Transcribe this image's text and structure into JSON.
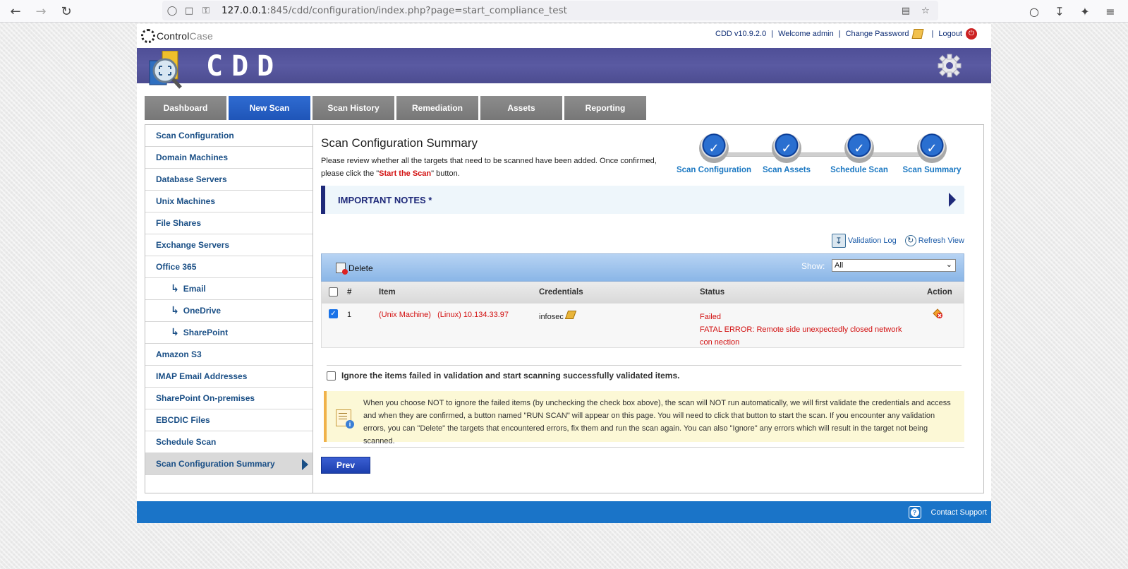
{
  "browser": {
    "url_host": "127.0.0.1",
    "url_rest": ":845/cdd/configuration/index.php?page=start_compliance_test"
  },
  "app": {
    "logo_left": "Control",
    "logo_right": "Case",
    "version": "CDD v10.9.2.0",
    "welcome": "Welcome admin",
    "change_password": "Change Password",
    "logout": "Logout",
    "brand": "CDD"
  },
  "tabs": [
    {
      "label": "Dashboard"
    },
    {
      "label": "New Scan"
    },
    {
      "label": "Scan History"
    },
    {
      "label": "Remediation"
    },
    {
      "label": "Assets"
    },
    {
      "label": "Reporting"
    }
  ],
  "sidebar": {
    "items": [
      {
        "label": "Scan Configuration"
      },
      {
        "label": "Domain Machines"
      },
      {
        "label": "Database Servers"
      },
      {
        "label": "Unix Machines"
      },
      {
        "label": "File Shares"
      },
      {
        "label": "Exchange Servers"
      },
      {
        "label": "Office 365"
      },
      {
        "label": "Email"
      },
      {
        "label": "OneDrive"
      },
      {
        "label": "SharePoint"
      },
      {
        "label": "Amazon S3"
      },
      {
        "label": "IMAP Email Addresses"
      },
      {
        "label": "SharePoint On-premises"
      },
      {
        "label": "EBCDIC Files"
      },
      {
        "label": "Schedule Scan"
      },
      {
        "label": "Scan Configuration Summary"
      }
    ]
  },
  "main": {
    "title": "Scan Configuration Summary",
    "desc_1": "Please review whether all the targets that need to be scanned have been added. Once confirmed, please click the \"",
    "desc_highlight": "Start the Scan",
    "desc_2": "\" button.",
    "steps": [
      {
        "label": "Scan Configuration"
      },
      {
        "label": "Scan Assets"
      },
      {
        "label": "Schedule Scan"
      },
      {
        "label": "Scan Summary"
      }
    ],
    "important_notes": "IMPORTANT NOTES *",
    "validation_log": "Validation Log",
    "refresh_view": "Refresh View"
  },
  "table": {
    "delete_label": "Delete",
    "show_label": "Show:",
    "show_value": "All",
    "headers": {
      "num": "#",
      "item": "Item",
      "credentials": "Credentials",
      "status": "Status",
      "action": "Action"
    },
    "rows": [
      {
        "num": "1",
        "item": "(Unix Machine)   (Linux) 10.134.33.97",
        "credentials": "infosec",
        "status": "Failed",
        "error": "FATAL ERROR: Remote side unexpectedly closed network con nection"
      }
    ]
  },
  "ignore_label": "Ignore the items failed in validation and start scanning successfully validated items.",
  "info_text": "When you choose NOT to ignore the failed items (by unchecking the check box above), the scan will NOT run automatically, we will first validate the credentials and access and when they are confirmed, a button named \"RUN SCAN\" will appear on this page. You will need to click that button to start the scan. If you encounter any validation errors, you can \"Delete\" the targets that encountered errors, fix them and run the scan again. You can also \"Ignore\" any errors which will result in the target not being scanned.",
  "prev_label": "Prev",
  "footer": {
    "contact_support": "Contact Support"
  },
  "icons": [
    "back-arrow-icon",
    "forward-arrow-icon",
    "reload-icon",
    "shield-icon",
    "page-icon",
    "key-icon",
    "reader-icon",
    "star-icon",
    "pocket-icon",
    "download-icon",
    "extensions-icon",
    "menu-icon",
    "gear-icon",
    "pencil-icon",
    "logout-icon",
    "check-icon",
    "triangle-right-icon",
    "validation-log-icon",
    "refresh-icon",
    "delete-icon",
    "chevron-down-icon",
    "action-icon",
    "info-note-icon",
    "help-icon"
  ],
  "colors": {
    "banner": "#5252a0",
    "active_tab": "#2362c8",
    "footer": "#1a74c8",
    "error": "#d20f0f",
    "link": "#1a4f86"
  }
}
